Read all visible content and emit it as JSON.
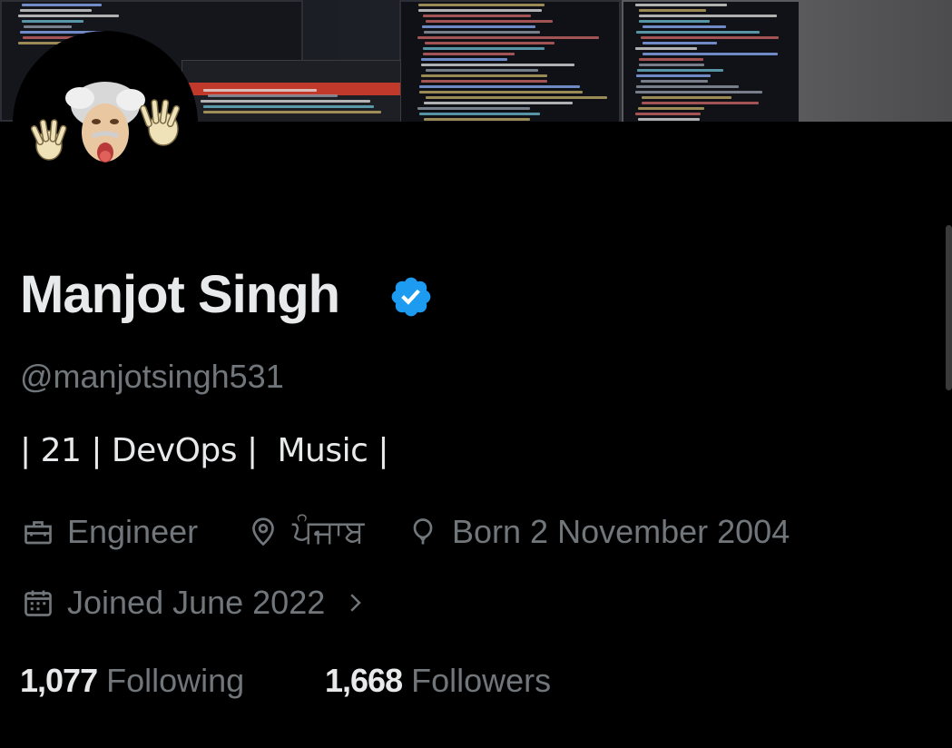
{
  "profile": {
    "name": "Manjot Singh",
    "handle": "@manjotsingh531",
    "bio": "| 21 | DevOps |  Music |",
    "verified_icon": "verified-badge-icon",
    "verified_color": "#1d9bf0"
  },
  "meta": {
    "profession": "Engineer",
    "location": "ਪੰਜਾਬ",
    "birthday": "Born 2 November 2004",
    "joined": "Joined June 2022"
  },
  "stats": {
    "following_count": "1,077",
    "following_label": "Following",
    "followers_count": "1,668",
    "followers_label": "Followers"
  },
  "colors": {
    "background": "#000000",
    "primary_text": "#e7e9ea",
    "secondary_text": "#71767b"
  }
}
